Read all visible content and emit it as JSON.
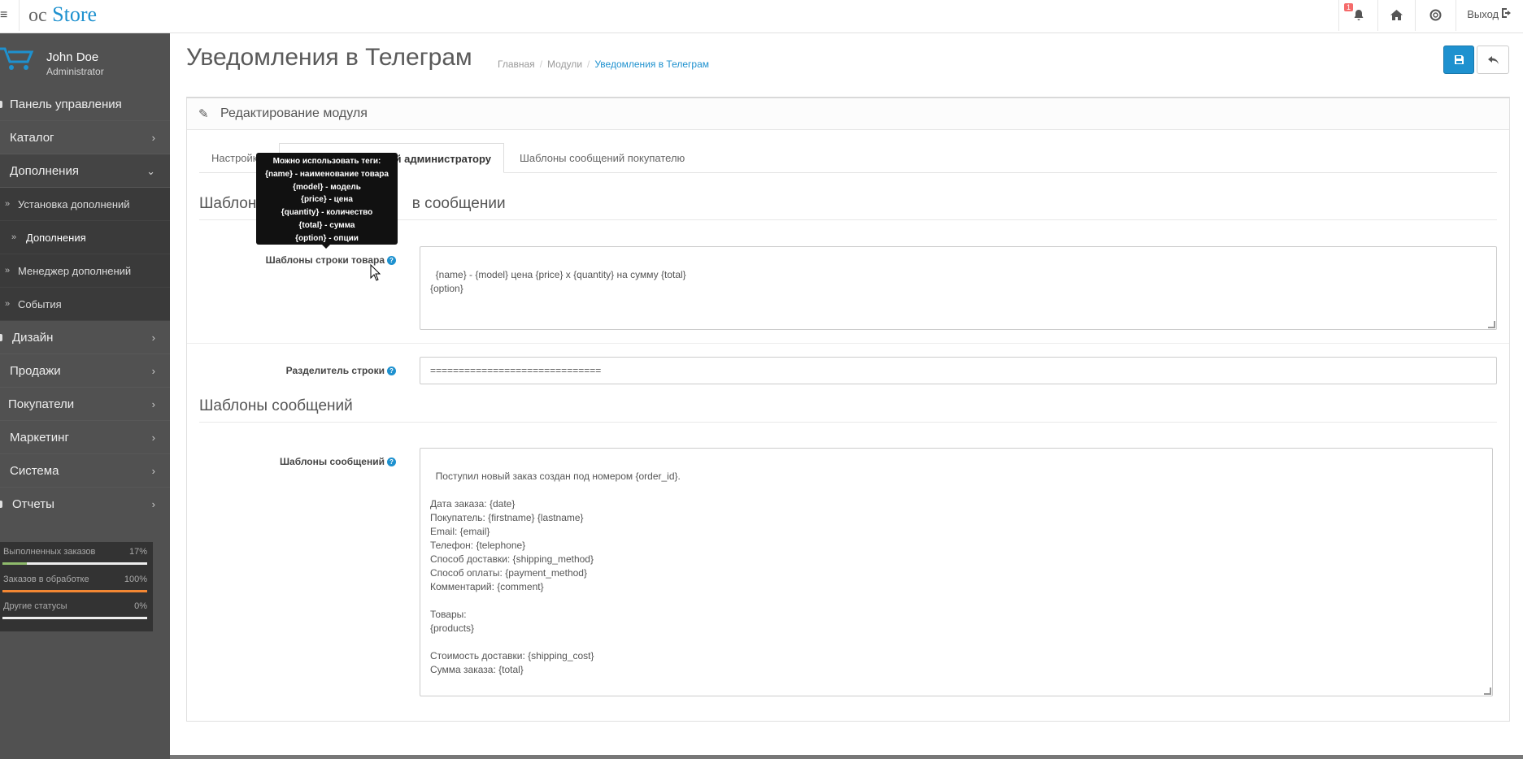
{
  "header": {
    "logo_oc": "oc",
    "logo_store": "Store",
    "notification_count": "1",
    "logout_label": "Выход"
  },
  "profile": {
    "name": "John Doe",
    "role": "Administrator"
  },
  "nav": {
    "dashboard": "Панель управления",
    "catalog": "Каталог",
    "extensions": "Дополнения",
    "sub": {
      "installer": "Установка дополнений",
      "extensions": "Дополнения",
      "manager": "Менеджер дополнений",
      "events": "События"
    },
    "design": "Дизайн",
    "sales": "Продажи",
    "customers": "Покупатели",
    "marketing": "Маркетинг",
    "system": "Система",
    "reports": "Отчеты"
  },
  "stats": [
    {
      "label": "Выполненных заказов",
      "value": "17%",
      "fraction": 0.17,
      "color": "#8fbb6c"
    },
    {
      "label": "Заказов в обработке",
      "value": "100%",
      "fraction": 1.0,
      "color": "#f38733"
    },
    {
      "label": "Другие статусы",
      "value": "0%",
      "fraction": 0.0,
      "color": "#ffffff"
    }
  ],
  "page": {
    "title": "Уведомления в Телеграм",
    "breadcrumb": [
      "Главная",
      "Модули",
      "Уведомления в Телеграм"
    ]
  },
  "panel": {
    "title": "Редактирование модуля"
  },
  "tabs": {
    "settings": "Настройки",
    "admin": "Шаблоны сообщений администратору",
    "customer": "Шаблоны сообщений покупателю",
    "admin_visible": "ий администратору"
  },
  "section1": {
    "title": "Шаблон вывода товаров в сообщении",
    "title_left": "Шаблон в",
    "title_right": "в сообщении"
  },
  "product_row": {
    "label": "Шаблоны строки товара",
    "value": "{name} - {model} цена {price} x {quantity} на сумму {total}\n{option}"
  },
  "separator": {
    "label": "Разделитель строки",
    "value": "=============================="
  },
  "section2": {
    "title": "Шаблоны сообщений"
  },
  "messages": {
    "label": "Шаблоны сообщений",
    "value": "Поступил новый заказ создан под номером {order_id}.\n\nДата заказа: {date}\nПокупатель: {firstname} {lastname}\nEmail: {email}\nТелефон: {telephone}\nСпособ доставки: {shipping_method}\nСпособ оплаты: {payment_method}\nКомментарий: {comment}\n\nТовары:\n{products}\n\nСтоимость доставки: {shipping_cost}\nСумма заказа: {total}"
  },
  "tooltip": {
    "lines": [
      "Можно использовать теги:",
      "{name} - наименование товара",
      "{model} - модель",
      "{price} - цена",
      "{quantity} - количество",
      "{total} - сумма",
      "{option} - опции"
    ]
  }
}
